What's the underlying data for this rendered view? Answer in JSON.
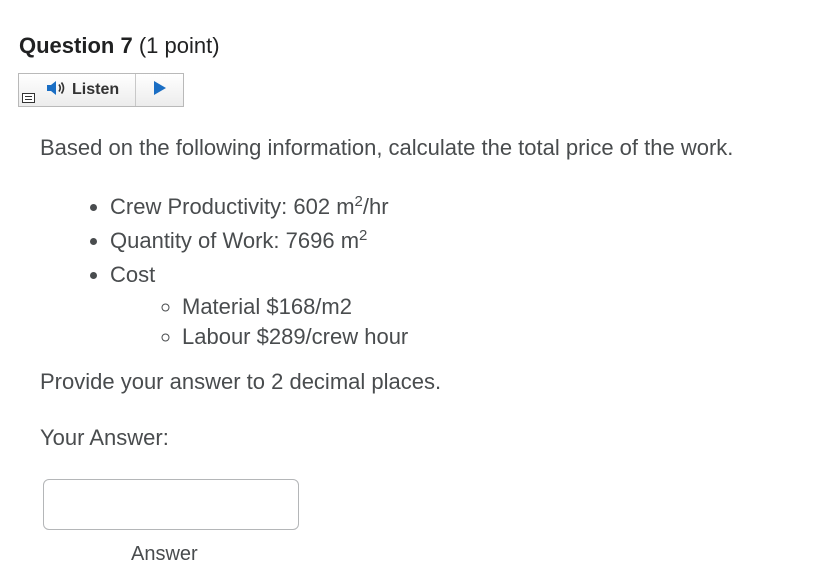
{
  "question": {
    "number_label": "Question 7",
    "points_label": "(1 point)"
  },
  "listen": {
    "label": "Listen",
    "speaker_icon": "speaker-icon",
    "play_icon": "play-icon",
    "menu_icon": "menu-icon"
  },
  "body": {
    "prompt": "Based on the following information, calculate the total price of the work.",
    "items": {
      "productivity_prefix": "Crew Productivity:  602 m",
      "productivity_sup": "2",
      "productivity_suffix": "/hr",
      "quantity_prefix": "Quantity of Work:  7696 m",
      "quantity_sup": "2",
      "cost_label": "Cost",
      "cost_items": [
        "Material $168/m2",
        "Labour $289/crew hour"
      ]
    },
    "hint": "Provide your answer to 2 decimal places.",
    "answer_label": "Your Answer:"
  },
  "answer": {
    "value": "",
    "caption": "Answer"
  },
  "colors": {
    "text": "#494c4e",
    "title": "#202122",
    "play": "#1a6ec4",
    "input_border": "#b4b6b8"
  }
}
